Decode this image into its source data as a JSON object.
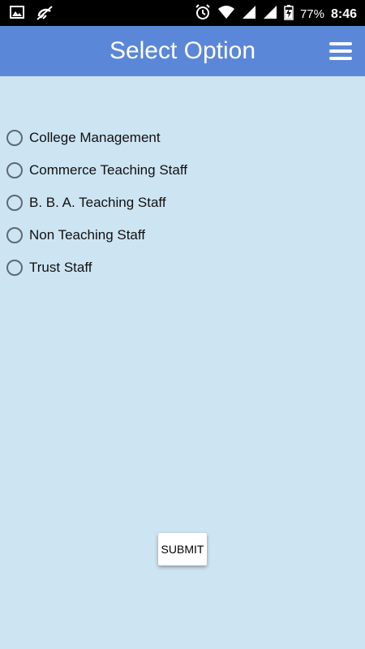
{
  "status_bar": {
    "left_icons": [
      "image-icon",
      "no-sync-icon"
    ],
    "battery": "77%",
    "time": "8:46"
  },
  "app_bar": {
    "title": "Select Option",
    "menu_icon": "hamburger-menu-icon",
    "color": "#5b87d8"
  },
  "options": [
    {
      "label": "College Management"
    },
    {
      "label": "Commerce Teaching Staff"
    },
    {
      "label": "B. B. A. Teaching Staff"
    },
    {
      "label": "Non Teaching Staff"
    },
    {
      "label": "Trust Staff"
    }
  ],
  "submit": {
    "label": "SUBMIT"
  },
  "background_color": "#cde4f2"
}
